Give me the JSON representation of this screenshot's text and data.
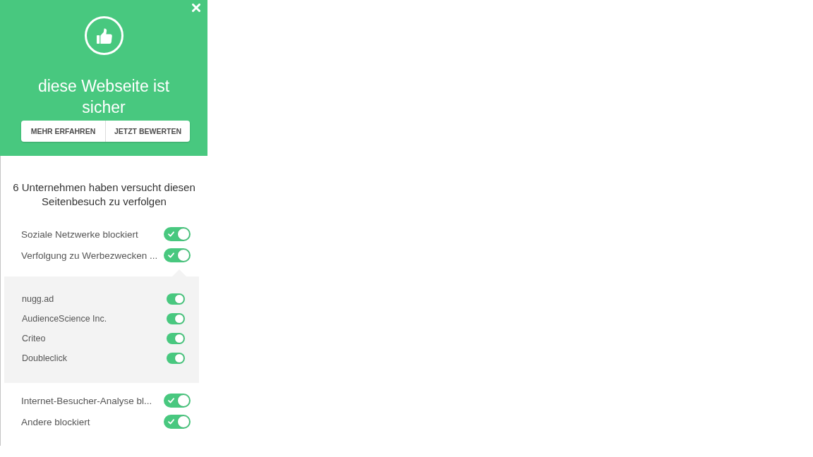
{
  "header": {
    "title": "diese Webseite ist sicher",
    "buttons": [
      "MEHR ERFAHREN",
      "JETZT BEWERTEN"
    ]
  },
  "summary": "6 Unternehmen haben versucht diesen Seitenbesuch zu verfolgen",
  "categories": [
    {
      "label": "Soziale Netzwerke blockiert",
      "on": true,
      "expanded": false
    },
    {
      "label": "Verfolgung zu Werbezwecken ...",
      "on": true,
      "expanded": true,
      "children": [
        {
          "label": "nugg.ad",
          "on": true
        },
        {
          "label": "AudienceScience Inc.",
          "on": true
        },
        {
          "label": "Criteo",
          "on": true
        },
        {
          "label": "Doubleclick",
          "on": true
        }
      ]
    },
    {
      "label": "Internet-Besucher-Analyse bl...",
      "on": true,
      "expanded": false
    },
    {
      "label": "Andere blockiert",
      "on": true,
      "expanded": false
    }
  ]
}
